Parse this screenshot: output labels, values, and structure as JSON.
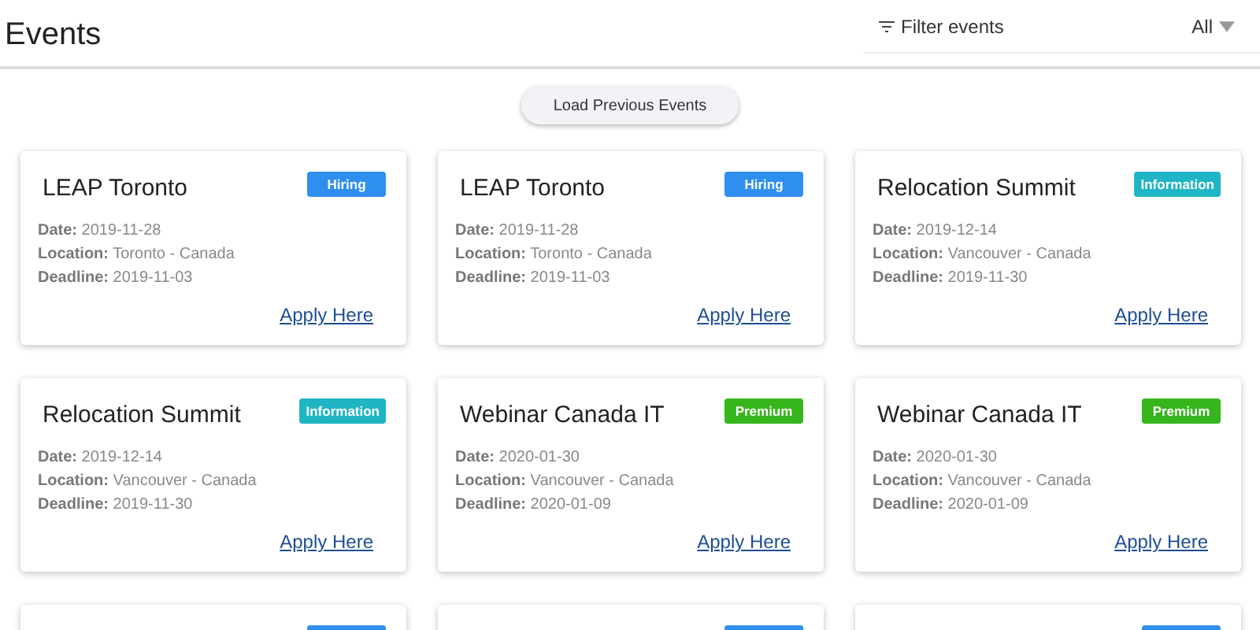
{
  "header": {
    "title": "Events",
    "filter": {
      "placeholder": "Filter events",
      "value": "All"
    }
  },
  "load_button": "Load Previous Events",
  "cards": [
    {
      "title": "LEAP Toronto",
      "kind": "hiring",
      "badge": "Hiring",
      "date_label": "Date:",
      "date": "2019-11-28",
      "location_label": "Location:",
      "location": "Toronto - Canada",
      "deadline_label": "Deadline:",
      "deadline": "2019-11-03",
      "link": "Apply Here"
    },
    {
      "title": "LEAP Toronto",
      "kind": "hiring",
      "badge": "Hiring",
      "date_label": "Date:",
      "date": "2019-11-28",
      "location_label": "Location:",
      "location": "Toronto - Canada",
      "deadline_label": "Deadline:",
      "deadline": "2019-11-03",
      "link": "Apply Here"
    },
    {
      "title": "Relocation Summit",
      "kind": "information",
      "badge": "Information",
      "date_label": "Date:",
      "date": "2019-12-14",
      "location_label": "Location:",
      "location": "Vancouver - Canada",
      "deadline_label": "Deadline:",
      "deadline": "2019-11-30",
      "link": "Apply Here"
    },
    {
      "title": "Relocation Summit",
      "kind": "information",
      "badge": "Information",
      "date_label": "Date:",
      "date": "2019-12-14",
      "location_label": "Location:",
      "location": "Vancouver - Canada",
      "deadline_label": "Deadline:",
      "deadline": "2019-11-30",
      "link": "Apply Here"
    },
    {
      "title": "Webinar Canada IT",
      "kind": "premium",
      "badge": "Premium",
      "date_label": "Date:",
      "date": "2020-01-30",
      "location_label": "Location:",
      "location": "Vancouver - Canada",
      "deadline_label": "Deadline:",
      "deadline": "2020-01-09",
      "link": "Apply Here"
    },
    {
      "title": "Webinar Canada IT",
      "kind": "premium",
      "badge": "Premium",
      "date_label": "Date:",
      "date": "2020-01-30",
      "location_label": "Location:",
      "location": "Vancouver - Canada",
      "deadline_label": "Deadline:",
      "deadline": "2020-01-09",
      "link": "Apply Here"
    },
    {
      "kind": "hiring"
    },
    {
      "kind": "hiring"
    },
    {
      "kind": "hiring"
    }
  ]
}
